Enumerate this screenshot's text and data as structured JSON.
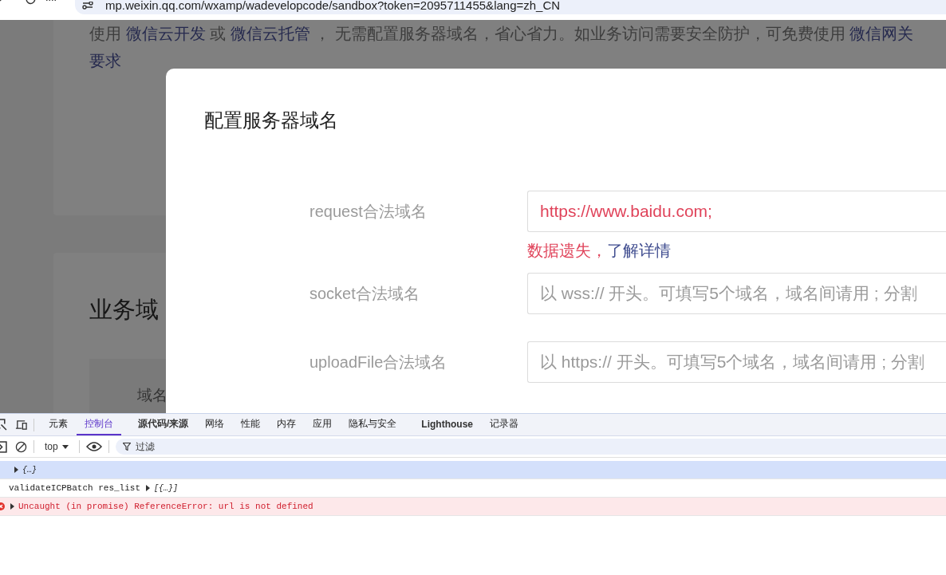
{
  "browser": {
    "url": "mp.weixin.qq.com/wxamp/wadevelopcode/sandbox?token=2095711455&lang=zh_CN"
  },
  "page": {
    "notice": [
      {
        "text": "使用 ",
        "kind": "text"
      },
      {
        "text": "微信云开发",
        "kind": "link"
      },
      {
        "text": " 或 ",
        "kind": "text"
      },
      {
        "text": "微信云托管",
        "kind": "link"
      },
      {
        "text": " ， 无需配置服务器域名，省心省力。如业务访问需要安全防护，可免费使用 ",
        "kind": "text"
      },
      {
        "text": "微信网关",
        "kind": "link"
      }
    ],
    "notice_continued": "要求",
    "section_title": "业务域",
    "table_header": "域名"
  },
  "dialog": {
    "title": "配置服务器域名",
    "fields": [
      {
        "label": "request合法域名",
        "value": "https://www.baidu.com;",
        "error": "数据遗失，",
        "error_link": "了解详情"
      },
      {
        "label": "socket合法域名",
        "placeholder": "以 wss:// 开头。可填写5个域名，域名间请用 ; 分割"
      },
      {
        "label": "uploadFile合法域名",
        "placeholder": "以 https:// 开头。可填写5个域名，域名间请用 ; 分割"
      }
    ]
  },
  "devtools": {
    "tabs": [
      {
        "label": "元素",
        "selected": false
      },
      {
        "label": "控制台",
        "selected": true
      },
      {
        "label": "源代码/来源",
        "selected": false
      },
      {
        "label": "网络",
        "selected": false
      },
      {
        "label": "性能",
        "selected": false
      },
      {
        "label": "内存",
        "selected": false
      },
      {
        "label": "应用",
        "selected": false
      },
      {
        "label": "隐私与安全",
        "selected": false
      },
      {
        "label": "Lighthouse",
        "selected": false
      },
      {
        "label": "记录器",
        "selected": false
      }
    ],
    "context": "top",
    "filter_placeholder": "过滤",
    "console": [
      {
        "kind": "object",
        "text": "{…}",
        "selected": true
      },
      {
        "kind": "log",
        "text": "validateICPBatch res_list",
        "object": "[{…}]",
        "selected": false
      },
      {
        "kind": "error",
        "text": "Uncaught (in promise) ReferenceError: url is not defined",
        "selected": false
      }
    ]
  }
}
